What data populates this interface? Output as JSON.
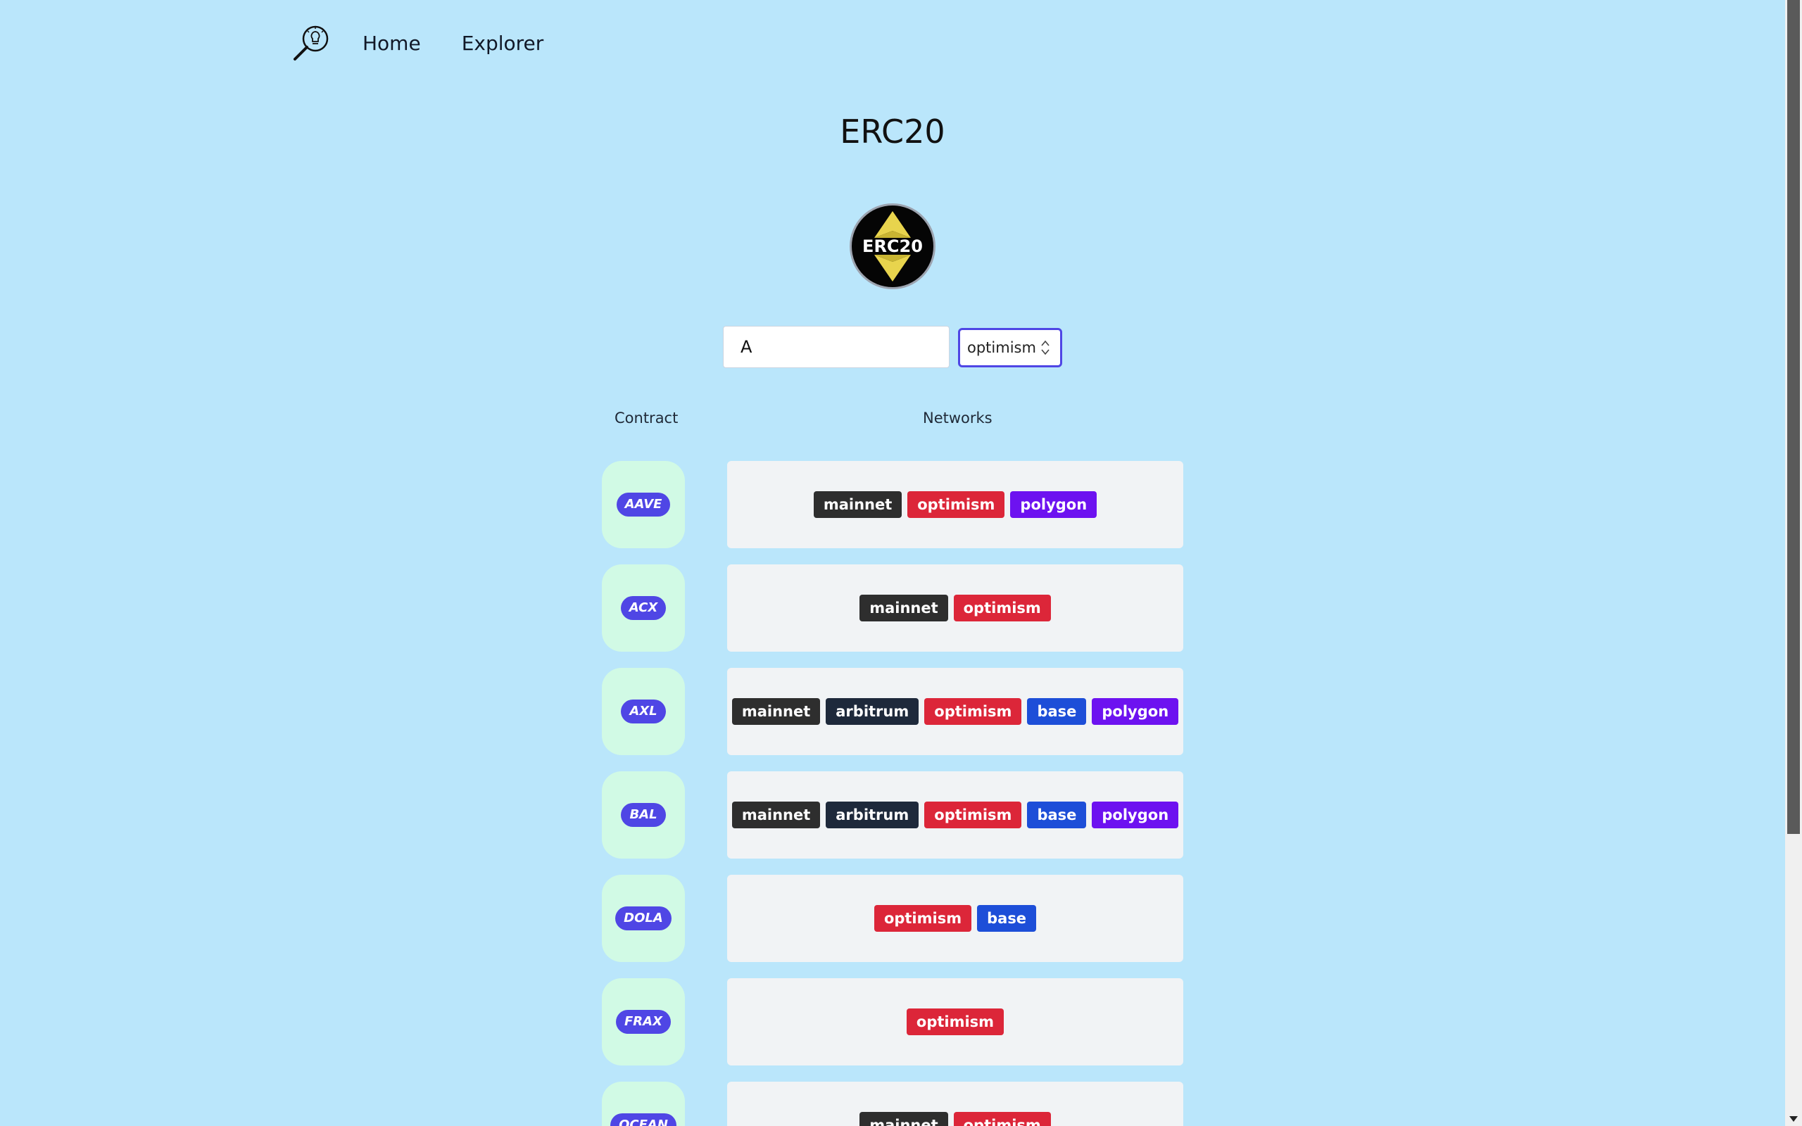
{
  "nav": {
    "logo_icon": "magnifier-bulb-icon",
    "links": [
      {
        "label": "Home"
      },
      {
        "label": "Explorer"
      }
    ]
  },
  "page": {
    "title": "ERC20",
    "token_logo_text": "ERC20"
  },
  "filters": {
    "search_value": "A",
    "network_selected": "optimism"
  },
  "table": {
    "headers": [
      "Contract",
      "Networks"
    ],
    "rows": [
      {
        "contract": "AAVE",
        "networks": [
          "mainnet",
          "optimism",
          "polygon"
        ]
      },
      {
        "contract": "ACX",
        "networks": [
          "mainnet",
          "optimism"
        ]
      },
      {
        "contract": "AXL",
        "networks": [
          "mainnet",
          "arbitrum",
          "optimism",
          "base",
          "polygon"
        ]
      },
      {
        "contract": "BAL",
        "networks": [
          "mainnet",
          "arbitrum",
          "optimism",
          "base",
          "polygon"
        ]
      },
      {
        "contract": "DOLA",
        "networks": [
          "optimism",
          "base"
        ]
      },
      {
        "contract": "FRAX",
        "networks": [
          "optimism"
        ]
      },
      {
        "contract": "OCEAN",
        "networks": [
          "mainnet",
          "optimism"
        ]
      }
    ]
  },
  "colors": {
    "background": "#bae6fb",
    "contract_badge": "#4f46e5",
    "mainnet": "#2e2e2e",
    "arbitrum": "#1e293b",
    "optimism": "#dc2639",
    "base": "#1d4ed8",
    "polygon": "#6d12f0"
  }
}
